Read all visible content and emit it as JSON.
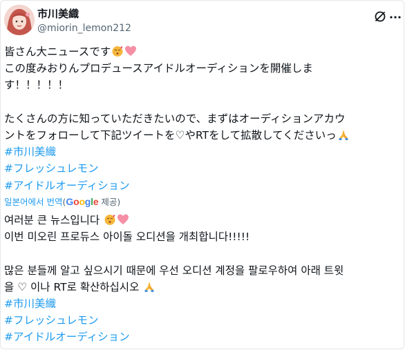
{
  "author": {
    "display_name": "市川美織",
    "handle": "@miorin_lemon212"
  },
  "icons": {
    "avatar": "profile-photo",
    "logo": "x-logo-icon",
    "more": "more-icon",
    "emoji_1": "kiss-face-emoji",
    "emoji_2": "pink-heart-emoji",
    "emoji_3": "folded-hands-emoji"
  },
  "original": {
    "line1": "皆さん大ニュースです",
    "line2": "この度みおりんプロデュースアイドルオーディションを開催しま",
    "line3": "す！！！！！",
    "line4": "たくさんの方に知っていただきたいので、まずはオーディションアカウ",
    "line5a": "ントをフォローして下記ツイートを",
    "line5heart": "♡",
    "line5b": "や",
    "line5c": "RT",
    "line5d": "をして拡散してくださいっ",
    "hashtags": [
      "#市川美織",
      "#フレッシュレモン",
      "#アイドルオーディション"
    ]
  },
  "translation": {
    "link_text": "일본어에서 번역",
    "paren_open": "(",
    "provider_g1": "G",
    "provider_o1": "o",
    "provider_o2": "o",
    "provider_g2": "g",
    "provider_l": "l",
    "provider_e": "e",
    "paren_close": " 제공)"
  },
  "translated": {
    "line1": "여러분 큰 뉴스입니다",
    "line2": "이번 미오린 프로듀스 아이돌 오디션을 개최합니다!!!!!",
    "line3": "많은 분들께 알고 싶으시기 때문에 우선 오디션 계정을 팔로우하여 아래 트윗",
    "line4a": "을 ",
    "line4heart": "♡",
    "line4b": " 이나 RT로 확산하십시오",
    "hashtags": [
      "#市川美織",
      "#フレッシュレモン",
      "#アイドルオーディション"
    ]
  },
  "colors": {
    "text": "#0f1419",
    "secondary": "#536471",
    "link": "#1d9bf0"
  }
}
